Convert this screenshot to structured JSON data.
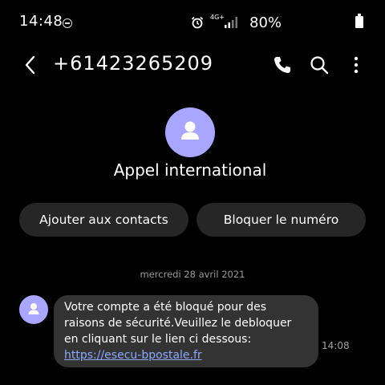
{
  "status_bar": {
    "time": "14:48",
    "network": "4G+",
    "battery": "80%"
  },
  "header": {
    "phone_number": "+61423265209"
  },
  "contact": {
    "name": "Appel international"
  },
  "actions": {
    "add_contact": "Ajouter aux contacts",
    "block_number": "Bloquer le numéro"
  },
  "conversation": {
    "date": "mercredi 28 avril 2021",
    "message": {
      "text": "Votre compte a été bloqué pour des raisons de sécurité.Veuillez le debloquer en cliquant sur le lien ci dessous: ",
      "link": "https://esecu-bpostale.fr",
      "time": "14:08"
    }
  },
  "colors": {
    "background": "#000000",
    "avatar": "#a9a6ff",
    "button_bg": "#262626",
    "bubble_bg": "#333333",
    "link": "#8aa9ff"
  },
  "icons": [
    "dnd-icon",
    "alarm-icon",
    "signal-icon",
    "battery-icon",
    "back-arrow-icon",
    "phone-icon",
    "search-icon",
    "more-vertical-icon",
    "person-icon"
  ]
}
